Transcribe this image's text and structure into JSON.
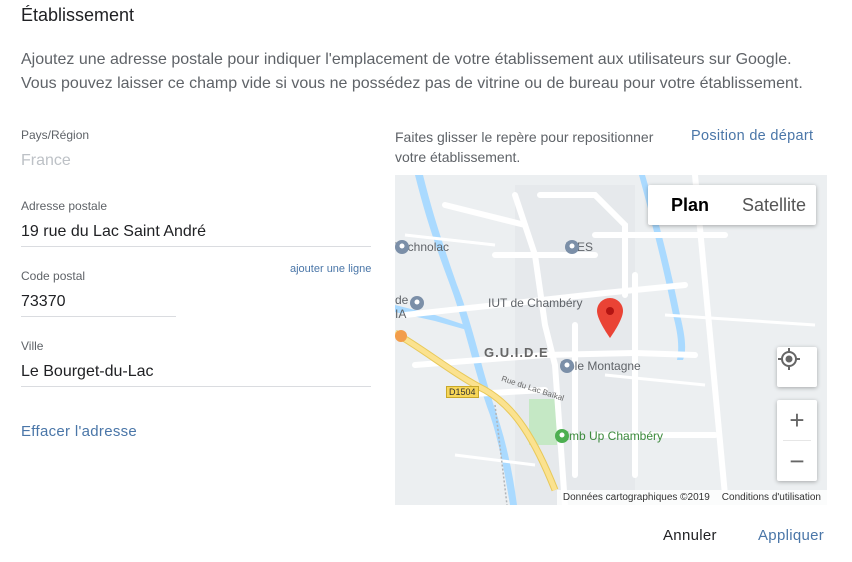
{
  "dialog": {
    "title": "Établissement",
    "description": "Ajoutez une adresse postale pour indiquer l'emplacement de votre établissement aux utilisateurs sur Google. Vous pouvez laisser ce champ vide si vous ne possédez pas de vitrine ou de bureau pour votre établissement."
  },
  "form": {
    "country_label": "Pays/Région",
    "country_value": "France",
    "address_label": "Adresse postale",
    "address_value": "19 rue du Lac Saint André",
    "add_line_link": "ajouter une ligne",
    "postal_label": "Code postal",
    "postal_value": "73370",
    "city_label": "Ville",
    "city_value": "Le Bourget-du-Lac",
    "clear_link": "Effacer l'adresse"
  },
  "map": {
    "hint": "Faites glisser le repère pour repositionner votre établissement.",
    "reset_link": "Position de départ",
    "type_plan": "Plan",
    "type_satellite": "Satellite",
    "zoom_in": "+",
    "zoom_out": "−",
    "attribution_data": "Données cartographiques ©2019",
    "attribution_terms": "Conditions d'utilisation",
    "poi_technolac": "Technolac",
    "poi_ines": "INES",
    "poi_iut": "IUT de Chambéry",
    "poi_guide": "G.U.I.D.E",
    "poi_pole": "Pôle Montagne",
    "poi_climb": "Climb Up Chambéry",
    "poi_de": "de",
    "poi_ia": "IA",
    "road_shield": "D1504",
    "road_name": "Rue du Lac Baïkal"
  },
  "actions": {
    "cancel": "Annuler",
    "apply": "Appliquer"
  },
  "colors": {
    "link": "#4a76a8",
    "marker": "#ea4335",
    "water": "#aadaff",
    "park": "#c5e8c5"
  }
}
